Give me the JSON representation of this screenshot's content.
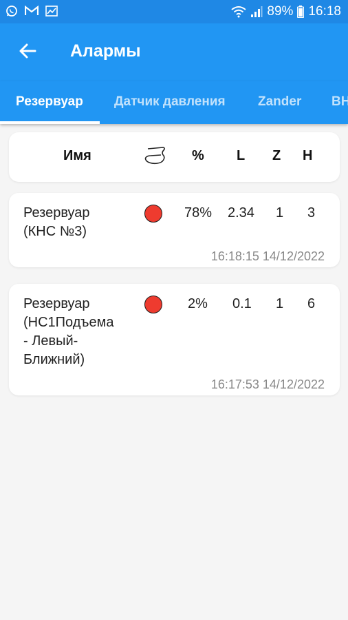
{
  "status_bar": {
    "icons_left": [
      "whatsapp-icon",
      "gmail-icon",
      "chart-notification-icon"
    ],
    "battery": "89%",
    "time": "16:18"
  },
  "app_bar": {
    "title": "Алармы",
    "back_icon": "arrow-left-icon"
  },
  "tabs": [
    {
      "label": "Резервуар",
      "active": true
    },
    {
      "label": "Датчик давления",
      "active": false
    },
    {
      "label": "Zander",
      "active": false
    },
    {
      "label": "ВН",
      "active": false
    }
  ],
  "columns": {
    "name": "Имя",
    "status_icon": "gauge-outline-icon",
    "percent": "%",
    "l": "L",
    "z": "Z",
    "h": "H"
  },
  "rows": [
    {
      "name_lines": [
        "Резервуар",
        "(КНС №3)"
      ],
      "status_color": "#ee3b2f",
      "percent": "78%",
      "l": "2.34",
      "z": "1",
      "h": "3",
      "timestamp": "16:18:15 14/12/2022"
    },
    {
      "name_lines": [
        "Резервуар",
        "(НС1Подъема",
        "- Левый-",
        "Ближний)"
      ],
      "status_color": "#ee3b2f",
      "percent": "2%",
      "l": "0.1",
      "z": "1",
      "h": "6",
      "timestamp": "16:17:53 14/12/2022"
    }
  ],
  "colors": {
    "primary": "#2196f3",
    "status_bar": "#1f88e5",
    "alarm_red": "#ee3b2f"
  }
}
